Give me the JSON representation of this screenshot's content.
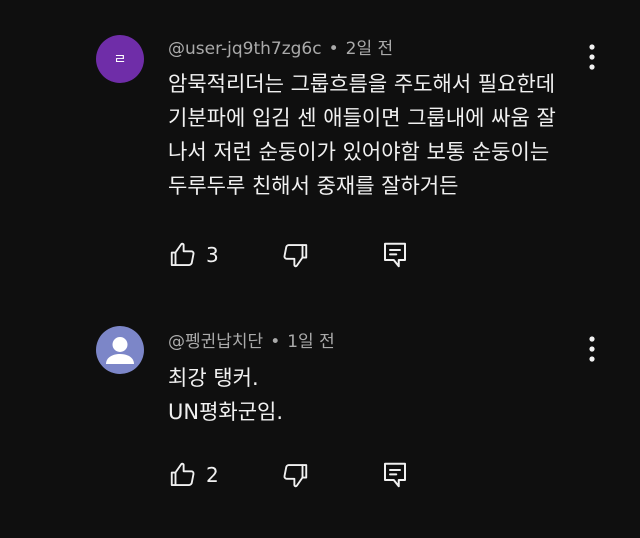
{
  "comments": [
    {
      "avatar_letter": "ㄹ",
      "author": "@user-jq9th7zg6c",
      "separator": "•",
      "time": "2일 전",
      "lines": [
        "암묵적리더는 그룹흐름을 주도해서 필요한데",
        "기분파에 입김 센 애들이면 그룹내에 싸움 잘",
        "나서 저런 순둥이가 있어야함 보통 순둥이는",
        "두루두루 친해서 중재를 잘하거든"
      ],
      "likes": "3"
    },
    {
      "author": "@펭귄납치단",
      "separator": "•",
      "time": "1일 전",
      "lines": [
        "최강 탱커.",
        "UN평화군임."
      ],
      "likes": "2"
    }
  ],
  "icons": {
    "like": "thumb-up-icon",
    "dislike": "thumb-down-icon",
    "reply": "reply-icon",
    "menu": "more-vert-icon"
  },
  "colors": {
    "background": "#0f0f0f",
    "text": "#f1f1f1",
    "meta_text": "#aaaaaa",
    "avatar_1": "#6f2da8",
    "avatar_2": "#7c86c8"
  }
}
